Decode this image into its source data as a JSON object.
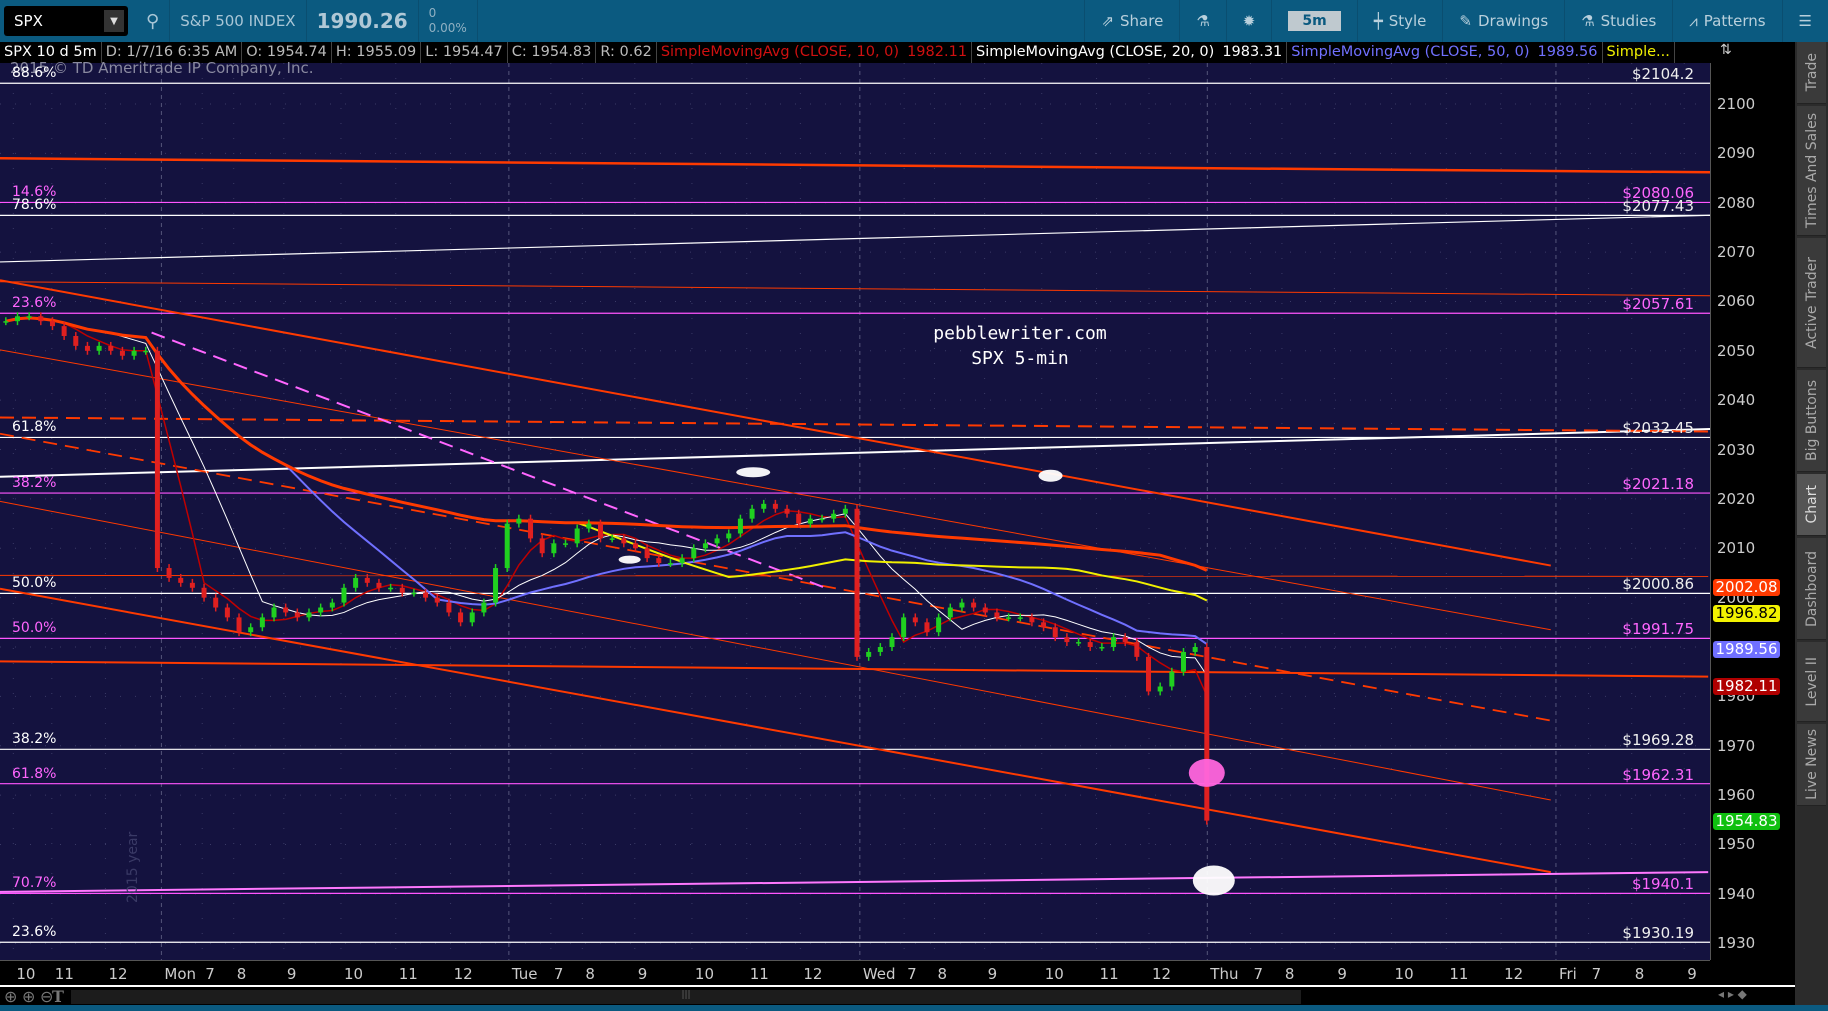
{
  "toolbar": {
    "symbol": "SPX",
    "name": "S&P 500 INDEX",
    "last": "1990.26",
    "change": "0",
    "change_pct": "0.00%",
    "share": "Share",
    "timeframe": "5m",
    "style": "Style",
    "drawings": "Drawings",
    "studies": "Studies",
    "patterns": "Patterns"
  },
  "legend": {
    "title": "SPX 10 d 5m",
    "date": "D: 1/7/16 6:35 AM",
    "open": "O: 1954.74",
    "high": "H: 1955.09",
    "low": "L: 1954.47",
    "close": "C: 1954.83",
    "range": "R: 0.62",
    "sma10": "SimpleMovingAvg (CLOSE, 10, 0)",
    "sma10_val": "1982.11",
    "sma20": "SimpleMovingAvg (CLOSE, 20, 0)",
    "sma20_val": "1983.31",
    "sma50": "SimpleMovingAvg (CLOSE, 50, 0)",
    "sma50_val": "1989.56",
    "more": "Simple..."
  },
  "watermark": "2015 © TD Ameritrade IP Company, Inc.",
  "side_watermark": "2015 year",
  "annotation": {
    "line1": "pebblewriter.com",
    "line2": "SPX 5-min"
  },
  "sidebar": [
    "Trade",
    "Times And Sales",
    "Active Trader",
    "Big Buttons",
    "Chart",
    "Dashboard",
    "Level II",
    "Live News"
  ],
  "price_tags": [
    {
      "value": "2002.08",
      "price": 2002.08,
      "bg": "#ff3a00",
      "fg": "#fff"
    },
    {
      "value": "1996.82",
      "price": 1996.82,
      "bg": "#f2f200",
      "fg": "#000"
    },
    {
      "value": "1989.56",
      "price": 1989.56,
      "bg": "#7070ff",
      "fg": "#fff"
    },
    {
      "value": "1982.11",
      "price": 1982.11,
      "bg": "#b00000",
      "fg": "#fff"
    },
    {
      "value": "1954.83",
      "price": 1954.83,
      "bg": "#10c010",
      "fg": "#fff"
    }
  ],
  "chart_data": {
    "type": "candlestick",
    "ylim": [
      1926.6,
      2108.3
    ],
    "y_ticks": [
      1930,
      1940,
      1950,
      1960,
      1970,
      1980,
      1990,
      2000,
      2010,
      2020,
      2030,
      2040,
      2050,
      2060,
      2070,
      2080,
      2090,
      2100
    ],
    "x_ticks": [
      {
        "label": "10",
        "bar": 0.9
      },
      {
        "label": "11",
        "bar": 4.2
      },
      {
        "label": "12",
        "bar": 8.8
      },
      {
        "label": "Mon",
        "bar": 13.6,
        "day": true
      },
      {
        "label": "7",
        "bar": 17.1
      },
      {
        "label": "8",
        "bar": 19.8
      },
      {
        "label": "9",
        "bar": 24.1
      },
      {
        "label": "10",
        "bar": 29
      },
      {
        "label": "11",
        "bar": 33.7
      },
      {
        "label": "12",
        "bar": 38.4
      },
      {
        "label": "Tue",
        "bar": 43.4,
        "day": true
      },
      {
        "label": "7",
        "bar": 47
      },
      {
        "label": "8",
        "bar": 49.7
      },
      {
        "label": "9",
        "bar": 54.2
      },
      {
        "label": "10",
        "bar": 59.1
      },
      {
        "label": "11",
        "bar": 63.8
      },
      {
        "label": "12",
        "bar": 68.4
      },
      {
        "label": "Wed",
        "bar": 73.5,
        "day": true
      },
      {
        "label": "7",
        "bar": 77.3
      },
      {
        "label": "8",
        "bar": 79.9
      },
      {
        "label": "9",
        "bar": 84.2
      },
      {
        "label": "10",
        "bar": 89.1
      },
      {
        "label": "11",
        "bar": 93.8
      },
      {
        "label": "12",
        "bar": 98.3
      },
      {
        "label": "Thu",
        "bar": 103.3,
        "day": true
      },
      {
        "label": "7",
        "bar": 107
      },
      {
        "label": "8",
        "bar": 109.7
      },
      {
        "label": "9",
        "bar": 114.2
      },
      {
        "label": "10",
        "bar": 119.1
      },
      {
        "label": "11",
        "bar": 123.8
      },
      {
        "label": "12",
        "bar": 128.5
      },
      {
        "label": "Fri",
        "bar": 133.2,
        "day": true
      },
      {
        "label": "7",
        "bar": 136
      },
      {
        "label": "8",
        "bar": 139.7
      },
      {
        "label": "9",
        "bar": 144.2
      }
    ],
    "closes": [
      2056,
      2057,
      2057,
      2056,
      2055,
      2053,
      2051,
      2050,
      2051,
      2050,
      2049,
      2050,
      2050,
      2006,
      2004,
      2003,
      2002,
      2000,
      1998,
      1996,
      1993,
      1994,
      1996,
      1998,
      1997,
      1996,
      1997,
      1998,
      1999,
      2002,
      2004,
      2003,
      2002,
      2002,
      2001,
      2001,
      2000,
      1999,
      1997,
      1995,
      1997,
      1999,
      2006,
      2015,
      2016,
      2012,
      2009,
      2011,
      2011,
      2014,
      2015,
      2012,
      2012,
      2011,
      2010,
      2008,
      2007,
      2007,
      2008,
      2010,
      2011,
      2012,
      2013,
      2016,
      2018,
      2019,
      2018,
      2017,
      2015,
      2016,
      2016,
      2017,
      2018,
      1988,
      1989,
      1990,
      1992,
      1996,
      1995,
      1993,
      1996,
      1998,
      1999,
      1998,
      1997,
      1996,
      1996,
      1996,
      1995,
      1994,
      1992,
      1991,
      1991,
      1990,
      1990,
      1992,
      1991,
      1988,
      1981,
      1982,
      1985,
      1989,
      1990,
      1954.83
    ],
    "moving_averages": [
      {
        "name": "SMA 10",
        "window": 5,
        "color": "#c00000",
        "width": 1.5
      },
      {
        "name": "SMA 20",
        "window": 10,
        "color": "#ffffff",
        "width": 1
      },
      {
        "name": "SMA 50",
        "window": 25,
        "color": "#7070ff",
        "width": 2
      },
      {
        "name": "SMA yellow",
        "window": 50,
        "color": "#f0f000",
        "width": 2
      },
      {
        "name": "SMA orange",
        "window": 100,
        "color": "#ff3a00",
        "width": 3
      }
    ],
    "levels": [
      {
        "left": "88.6%",
        "right": "$2104.2",
        "price": 2104.2,
        "color": "#ffffff"
      },
      {
        "left": "14.6%",
        "right": "$2080.06",
        "price": 2080.06,
        "color": "#ff55ff"
      },
      {
        "left": "78.6%",
        "right": "$2077.43",
        "price": 2077.43,
        "color": "#ffffff"
      },
      {
        "left": "23.6%",
        "right": "$2057.61",
        "price": 2057.61,
        "color": "#ff55ff"
      },
      {
        "left": "61.8%",
        "right": "$2032.45",
        "price": 2032.45,
        "color": "#ffffff"
      },
      {
        "left": "38.2%",
        "right": "$2021.18",
        "price": 2021.18,
        "color": "#ff55ff"
      },
      {
        "left": "50.0%",
        "right": "$2000.86",
        "price": 2000.86,
        "color": "#ffffff"
      },
      {
        "left": "50.0%",
        "right": "$1991.75",
        "price": 1991.75,
        "color": "#ff55ff"
      },
      {
        "left": "38.2%",
        "right": "$1969.28",
        "price": 1969.28,
        "color": "#ffffff"
      },
      {
        "left": "61.8%",
        "right": "$1962.31",
        "price": 1962.31,
        "color": "#ff55ff"
      },
      {
        "left": "70.7%",
        "right": "$1940.1",
        "price": 1940.1,
        "color": "#ff55ff"
      },
      {
        "left": "23.6%",
        "right": "$1930.19",
        "price": 1930.19,
        "color": "#ffffff"
      }
    ],
    "trendlines": [
      {
        "from": [
          -0.5,
          2089
        ],
        "to": [
          154.5,
          2086
        ],
        "color": "#ff3a00",
        "width": 2.5
      },
      {
        "from": [
          -0.5,
          2068
        ],
        "to": [
          154.5,
          2078
        ],
        "color": "#ffffff",
        "width": 1.2
      },
      {
        "from": [
          -0.5,
          2024.5
        ],
        "to": [
          154.5,
          2034.7
        ],
        "color": "#ffffff",
        "width": 2
      },
      {
        "from": [
          -0.5,
          2036.5
        ],
        "to": [
          154.5,
          2033.5
        ],
        "color": "#ff3a00",
        "width": 2,
        "dash": true
      },
      {
        "from": [
          -0.5,
          2064
        ],
        "to": [
          154.5,
          2061
        ],
        "color": "#ff3a00",
        "width": 1
      },
      {
        "from": [
          -0.5,
          2064.3
        ],
        "to": [
          132.5,
          2006.5
        ],
        "color": "#ff3a00",
        "width": 2
      },
      {
        "from": [
          -0.5,
          2050.2
        ],
        "to": [
          132.5,
          1993.5
        ],
        "color": "#ff3a00",
        "width": 1
      },
      {
        "from": [
          -0.5,
          2019.5
        ],
        "to": [
          132.5,
          1959
        ],
        "color": "#ff3a00",
        "width": 1
      },
      {
        "from": [
          -0.5,
          2001.8
        ],
        "to": [
          132.5,
          1944.4
        ],
        "color": "#ff3a00",
        "width": 2
      },
      {
        "from": [
          -0.5,
          2033.2
        ],
        "to": [
          132.5,
          1975.1
        ],
        "color": "#ff3a00",
        "width": 1.8,
        "dash": true
      },
      {
        "from": [
          12.5,
          2053.7
        ],
        "to": [
          70.5,
          2001.8
        ],
        "color": "#ff66ff",
        "width": 2,
        "dash": true
      },
      {
        "from": [
          -0.5,
          1940.4
        ],
        "to": [
          146,
          1944.4
        ],
        "color": "#ff77ff",
        "width": 2
      },
      {
        "from": [
          -0.5,
          1987.1
        ],
        "to": [
          146,
          1984
        ],
        "color": "#ff3a00",
        "width": 2
      },
      {
        "from": [
          -0.5,
          2004.5
        ],
        "to": [
          146,
          2004.3
        ],
        "color": "#ff3a00",
        "width": 1
      }
    ],
    "markers": [
      {
        "bar": 103,
        "price": 1964.5,
        "color": "#ff66dd",
        "rx": 18,
        "ry": 14
      },
      {
        "bar": 103.6,
        "price": 1942.7,
        "color": "#ffffff",
        "rx": 21,
        "ry": 15
      },
      {
        "bar": 64.1,
        "price": 2025.4,
        "color": "#ffffff",
        "rx": 17,
        "ry": 5
      },
      {
        "bar": 89.6,
        "price": 2024.7,
        "color": "#ffffff",
        "rx": 12,
        "ry": 6
      },
      {
        "bar": 53.5,
        "price": 2007.7,
        "color": "#ffffff",
        "rx": 11,
        "ry": 4
      }
    ]
  }
}
